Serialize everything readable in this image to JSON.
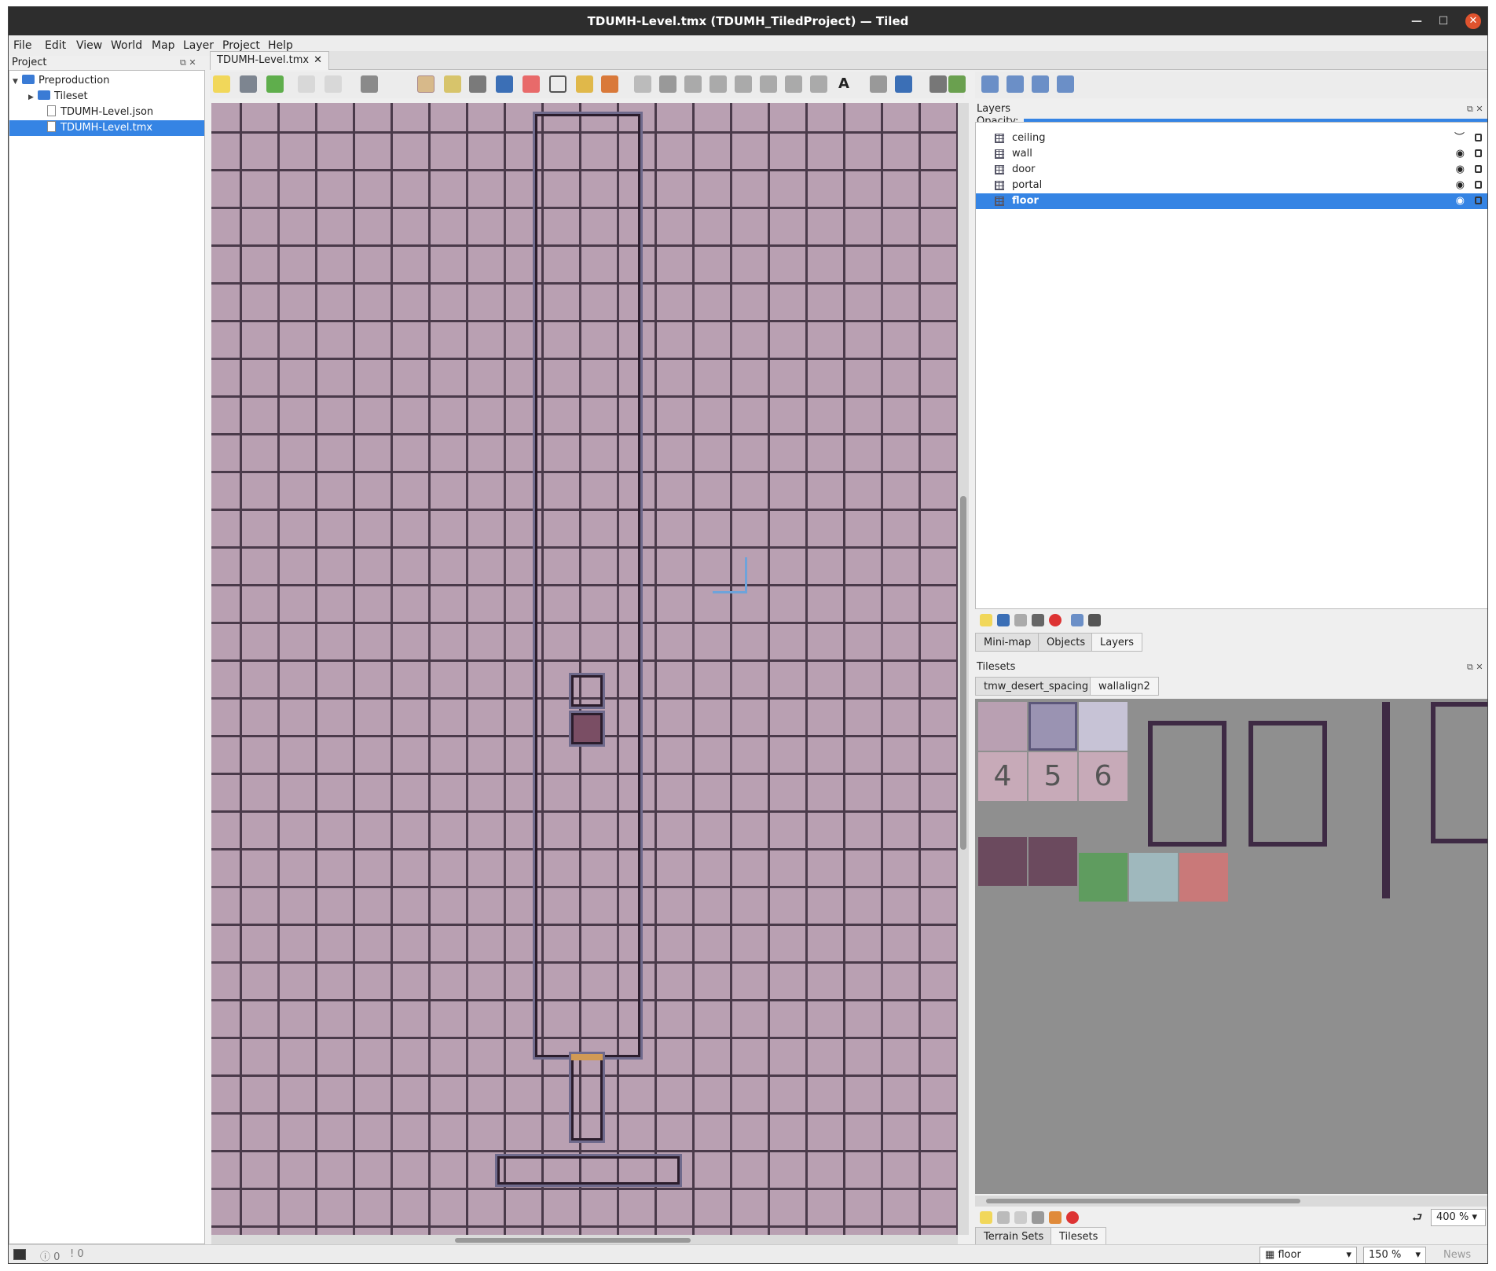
{
  "window": {
    "title": "TDUMH-Level.tmx (TDUMH_TiledProject) — Tiled"
  },
  "menu": [
    "File",
    "Edit",
    "View",
    "World",
    "Map",
    "Layer",
    "Project",
    "Help"
  ],
  "project": {
    "title": "Project",
    "items": [
      {
        "label": "Preproduction",
        "kind": "folder"
      },
      {
        "label": "Tileset",
        "kind": "folder"
      },
      {
        "label": "TDUMH-Level.json",
        "kind": "file"
      },
      {
        "label": "TDUMH-Level.tmx",
        "kind": "file",
        "selected": true
      }
    ]
  },
  "document_tab": {
    "label": "TDUMH-Level.tmx"
  },
  "layers_panel": {
    "title": "Layers",
    "opacity_label": "Opacity:",
    "opacity": 1.0,
    "layers": [
      {
        "name": "ceiling",
        "visible": false
      },
      {
        "name": "wall",
        "visible": true
      },
      {
        "name": "door",
        "visible": true
      },
      {
        "name": "portal",
        "visible": true
      },
      {
        "name": "floor",
        "visible": true,
        "selected": true
      }
    ],
    "tabs": [
      "Mini-map",
      "Objects",
      "Layers"
    ],
    "active_tab": "Layers"
  },
  "tilesets_panel": {
    "title": "Tilesets",
    "tabs": [
      "tmw_desert_spacing",
      "wallalign2"
    ],
    "active_tab": "wallalign2",
    "zoom": "400 %",
    "number_tiles": [
      "4",
      "5",
      "6"
    ],
    "colors": {
      "green": "#5f9c5f",
      "blue": "#9fb8bd",
      "red": "#c97979"
    },
    "bottom_tabs": [
      "Terrain Sets",
      "Tilesets"
    ],
    "active_bottom_tab": "Tilesets"
  },
  "statusbar": {
    "errors": "0",
    "warnings": "0",
    "layer": "floor",
    "zoom": "150 %",
    "news": "News"
  },
  "colors": {
    "selection": "#3584e4",
    "floor": "#b9a0b2",
    "titlebar": "#2d2d2d"
  }
}
